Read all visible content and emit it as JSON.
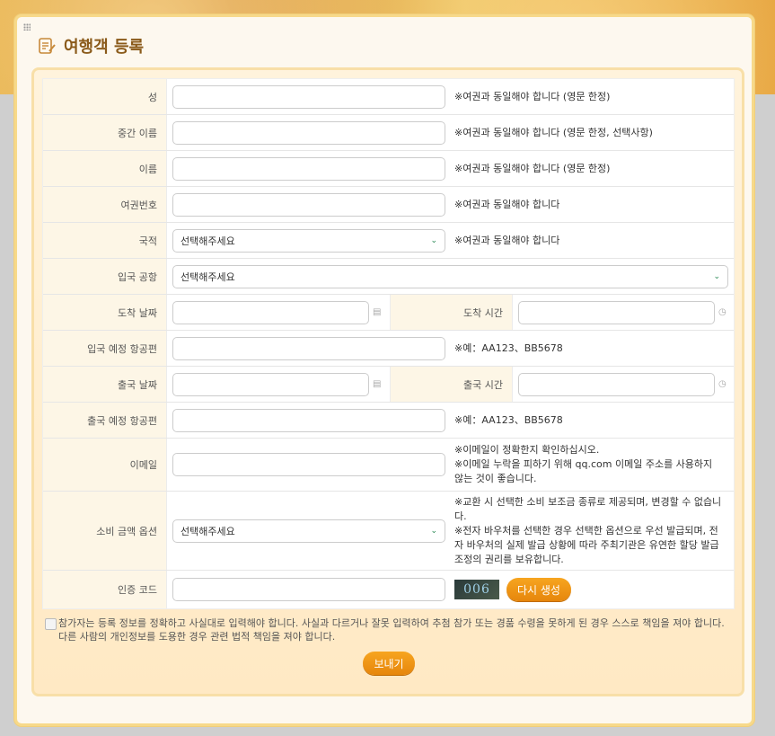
{
  "title": "여행객 등록",
  "rows": {
    "surname": {
      "label": "성",
      "note": "※여권과 동일해야 합니다 (영문 한정)"
    },
    "middle": {
      "label": "중간 이름",
      "note": "※여권과 동일해야 합니다 (영문 한정, 선택사항)"
    },
    "given": {
      "label": "이름",
      "note": "※여권과 동일해야 합니다 (영문 한정)"
    },
    "passport": {
      "label": "여권번호",
      "note": "※여권과 동일해야 합니다"
    },
    "nationality": {
      "label": "국적",
      "value": "선택해주세요",
      "note": "※여권과 동일해야 합니다"
    },
    "entry_airport": {
      "label": "입국 공항",
      "value": "선택해주세요"
    },
    "arrival_date": {
      "label": "도착 날짜"
    },
    "arrival_time": {
      "label": "도착 시간"
    },
    "entry_flight": {
      "label": "입국 예정 항공편",
      "note": "※예：AA123、BB5678"
    },
    "departure_date": {
      "label": "출국 날짜"
    },
    "departure_time": {
      "label": "출국 시간"
    },
    "exit_flight": {
      "label": "출국 예정 항공편",
      "note": "※예：AA123、BB5678"
    },
    "email": {
      "label": "이메일",
      "note1": "※이메일이 정확한지 확인하십시오.",
      "note2": "※이메일 누락을 피하기 위해 qq.com 이메일 주소를 사용하지 않는 것이 좋습니다."
    },
    "amount": {
      "label": "소비 금액 옵션",
      "value": "선택해주세요",
      "note1": "※교환 시 선택한 소비 보조금 종류로 제공되며, 변경할 수 없습니다.",
      "note2": "※전자 바우처를 선택한 경우 선택한 옵션으로 우선 발급되며, 전자 바우처의 실제 발급 상황에 따라 주최기관은 유연한 할당 발급 조정의 권리를 보유합니다."
    },
    "captcha": {
      "label": "인증 코드",
      "image_text": "006",
      "regen": "다시 생성"
    }
  },
  "agreement": "참가자는 등록 정보를 정확하고 사실대로 입력해야 합니다. 사실과 다르거나 잘못 입력하여 추첨 참가 또는 경품 수령을 못하게 된 경우 스스로 책임을 져야 합니다. 다른 사람의 개인정보를 도용한 경우 관련 법적 책임을 져야 합니다.",
  "submit": "보내기"
}
